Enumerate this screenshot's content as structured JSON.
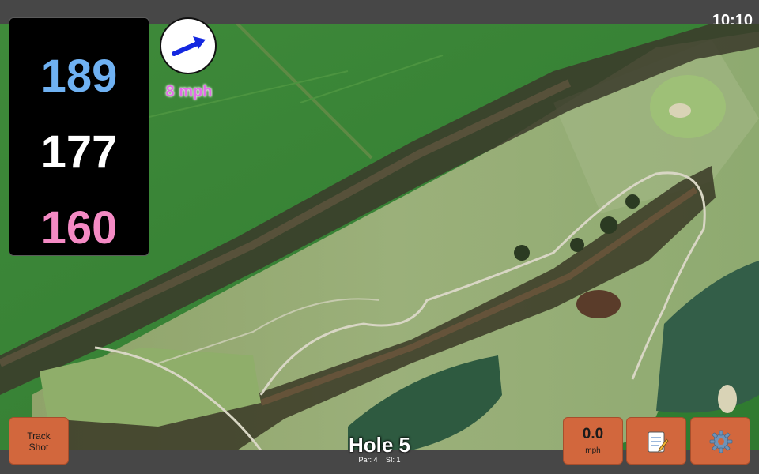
{
  "status_bar": {
    "time": "10:10"
  },
  "yardage": {
    "back": "189",
    "middle": "177",
    "front": "160"
  },
  "wind": {
    "speed": "8 mph",
    "direction_icon": "wind-arrow-icon"
  },
  "buttons": {
    "track_shot_line1": "Track",
    "track_shot_line2": "Shot",
    "speed_value": "0.0",
    "speed_unit": "mph",
    "notes_icon": "notepad-icon",
    "settings_icon": "gear-icon"
  },
  "hole": {
    "title": "Hole 5",
    "par": "Par: 4",
    "si": "SI: 1"
  },
  "colors": {
    "back": "#6fb1f2",
    "middle": "#ffffff",
    "front": "#f48ac4",
    "button": "#d2673d",
    "wind_text": "#e36ee8"
  }
}
